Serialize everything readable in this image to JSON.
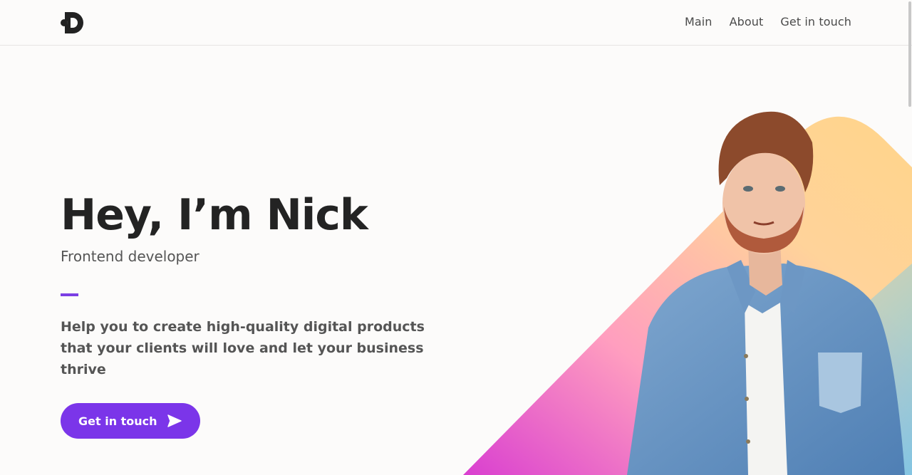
{
  "header": {
    "logo_icon": "d-logo-icon",
    "nav": [
      {
        "label": "Main"
      },
      {
        "label": "About"
      },
      {
        "label": "Get in touch"
      }
    ]
  },
  "hero": {
    "title": "Hey, I’m Nick",
    "subtitle": "Frontend developer",
    "description": "Help you to create high-quality digital products that your clients will love and let your business thrive",
    "cta_label": "Get in touch",
    "cta_icon": "send-icon",
    "accent_color": "#7b35e9"
  },
  "image": {
    "icon": "portrait-photo"
  }
}
